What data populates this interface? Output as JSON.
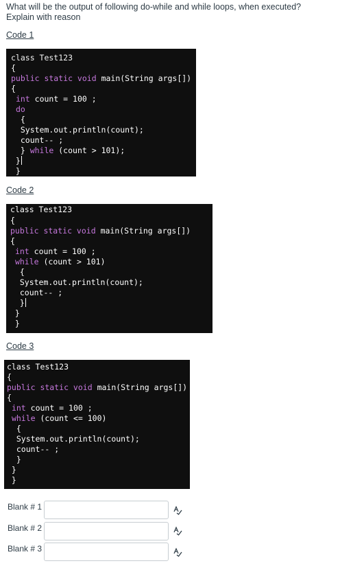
{
  "question": {
    "line1": "What will be the output of following do-while and while loops, when executed?",
    "line2": "Explain with reason"
  },
  "code1": {
    "heading": "Code 1",
    "lines": [
      "class Test123",
      "{",
      "public static void main(String args[])",
      "{",
      " int count = 100 ;",
      " do",
      "  {",
      "  System.out.println(count);",
      "  count-- ;",
      "  } while (count > 101);",
      " }",
      " }"
    ]
  },
  "code2": {
    "heading": "Code 2",
    "lines": [
      "class Test123",
      "{",
      "public static void main(String args[])",
      "{",
      " int count = 100 ;",
      " while (count > 101)",
      "  {",
      "  System.out.println(count);",
      "  count-- ;",
      "  }",
      " }",
      " }"
    ]
  },
  "code3": {
    "heading": "Code 3",
    "lines": [
      "class Test123",
      "{",
      "public static void main(String args[])",
      "{",
      " int count = 100 ;",
      " while (count <= 100)",
      "  {",
      "  System.out.println(count);",
      "  count-- ;",
      "  }",
      " }",
      " }"
    ]
  },
  "blanks": [
    {
      "label": "Blank # 1",
      "value": ""
    },
    {
      "label": "Blank # 2",
      "value": ""
    },
    {
      "label": "Blank # 3",
      "value": ""
    }
  ],
  "icons": {
    "spellcheck": "spellcheck-icon"
  },
  "colors": {
    "code_background": "#0f0f0f",
    "keyword": "#c678dd",
    "text": "#2d3b45",
    "input_border": "#c7cdd1"
  }
}
